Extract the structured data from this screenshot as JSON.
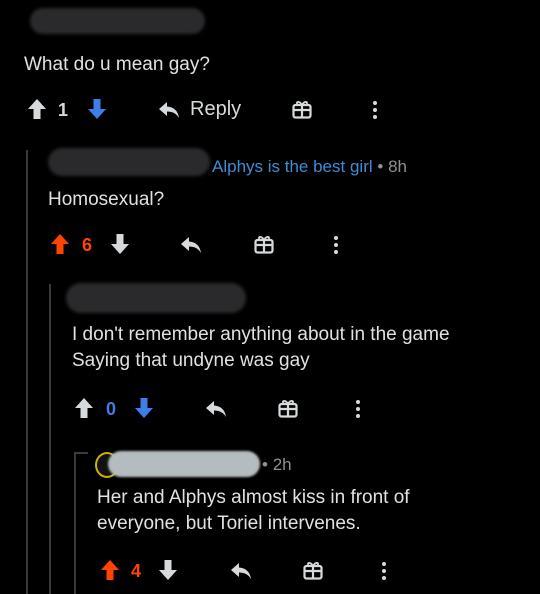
{
  "comment1": {
    "body": "What do u mean gay?",
    "score": "1",
    "reply_label": "Reply",
    "icons": [
      "upvote-icon",
      "downvote-icon",
      "reply-icon",
      "gift-icon",
      "more-icon"
    ]
  },
  "comment2": {
    "flair": "Alphys is the best girl",
    "separator": "•",
    "time": "8h",
    "body": "Homosexual?",
    "score": "6",
    "upvote_color": "#ff4500"
  },
  "comment3": {
    "body_line1": "I don't remember anything about in the game",
    "body_line2": "Saying that undyne was gay",
    "score": "0",
    "downvote_color": "#3d7ee8"
  },
  "comment4": {
    "separator": "•",
    "time": "2h",
    "body_line1": "Her and Alphys almost kiss in front of",
    "body_line2": "everyone, but Toriel intervenes.",
    "score": "4",
    "upvote_color": "#ff4500"
  },
  "colors": {
    "background": "#000000",
    "upvote": "#ff4500",
    "downvote": "#3d7ee8",
    "flair": "#3d8ed6",
    "text": "#dfe1e3"
  }
}
